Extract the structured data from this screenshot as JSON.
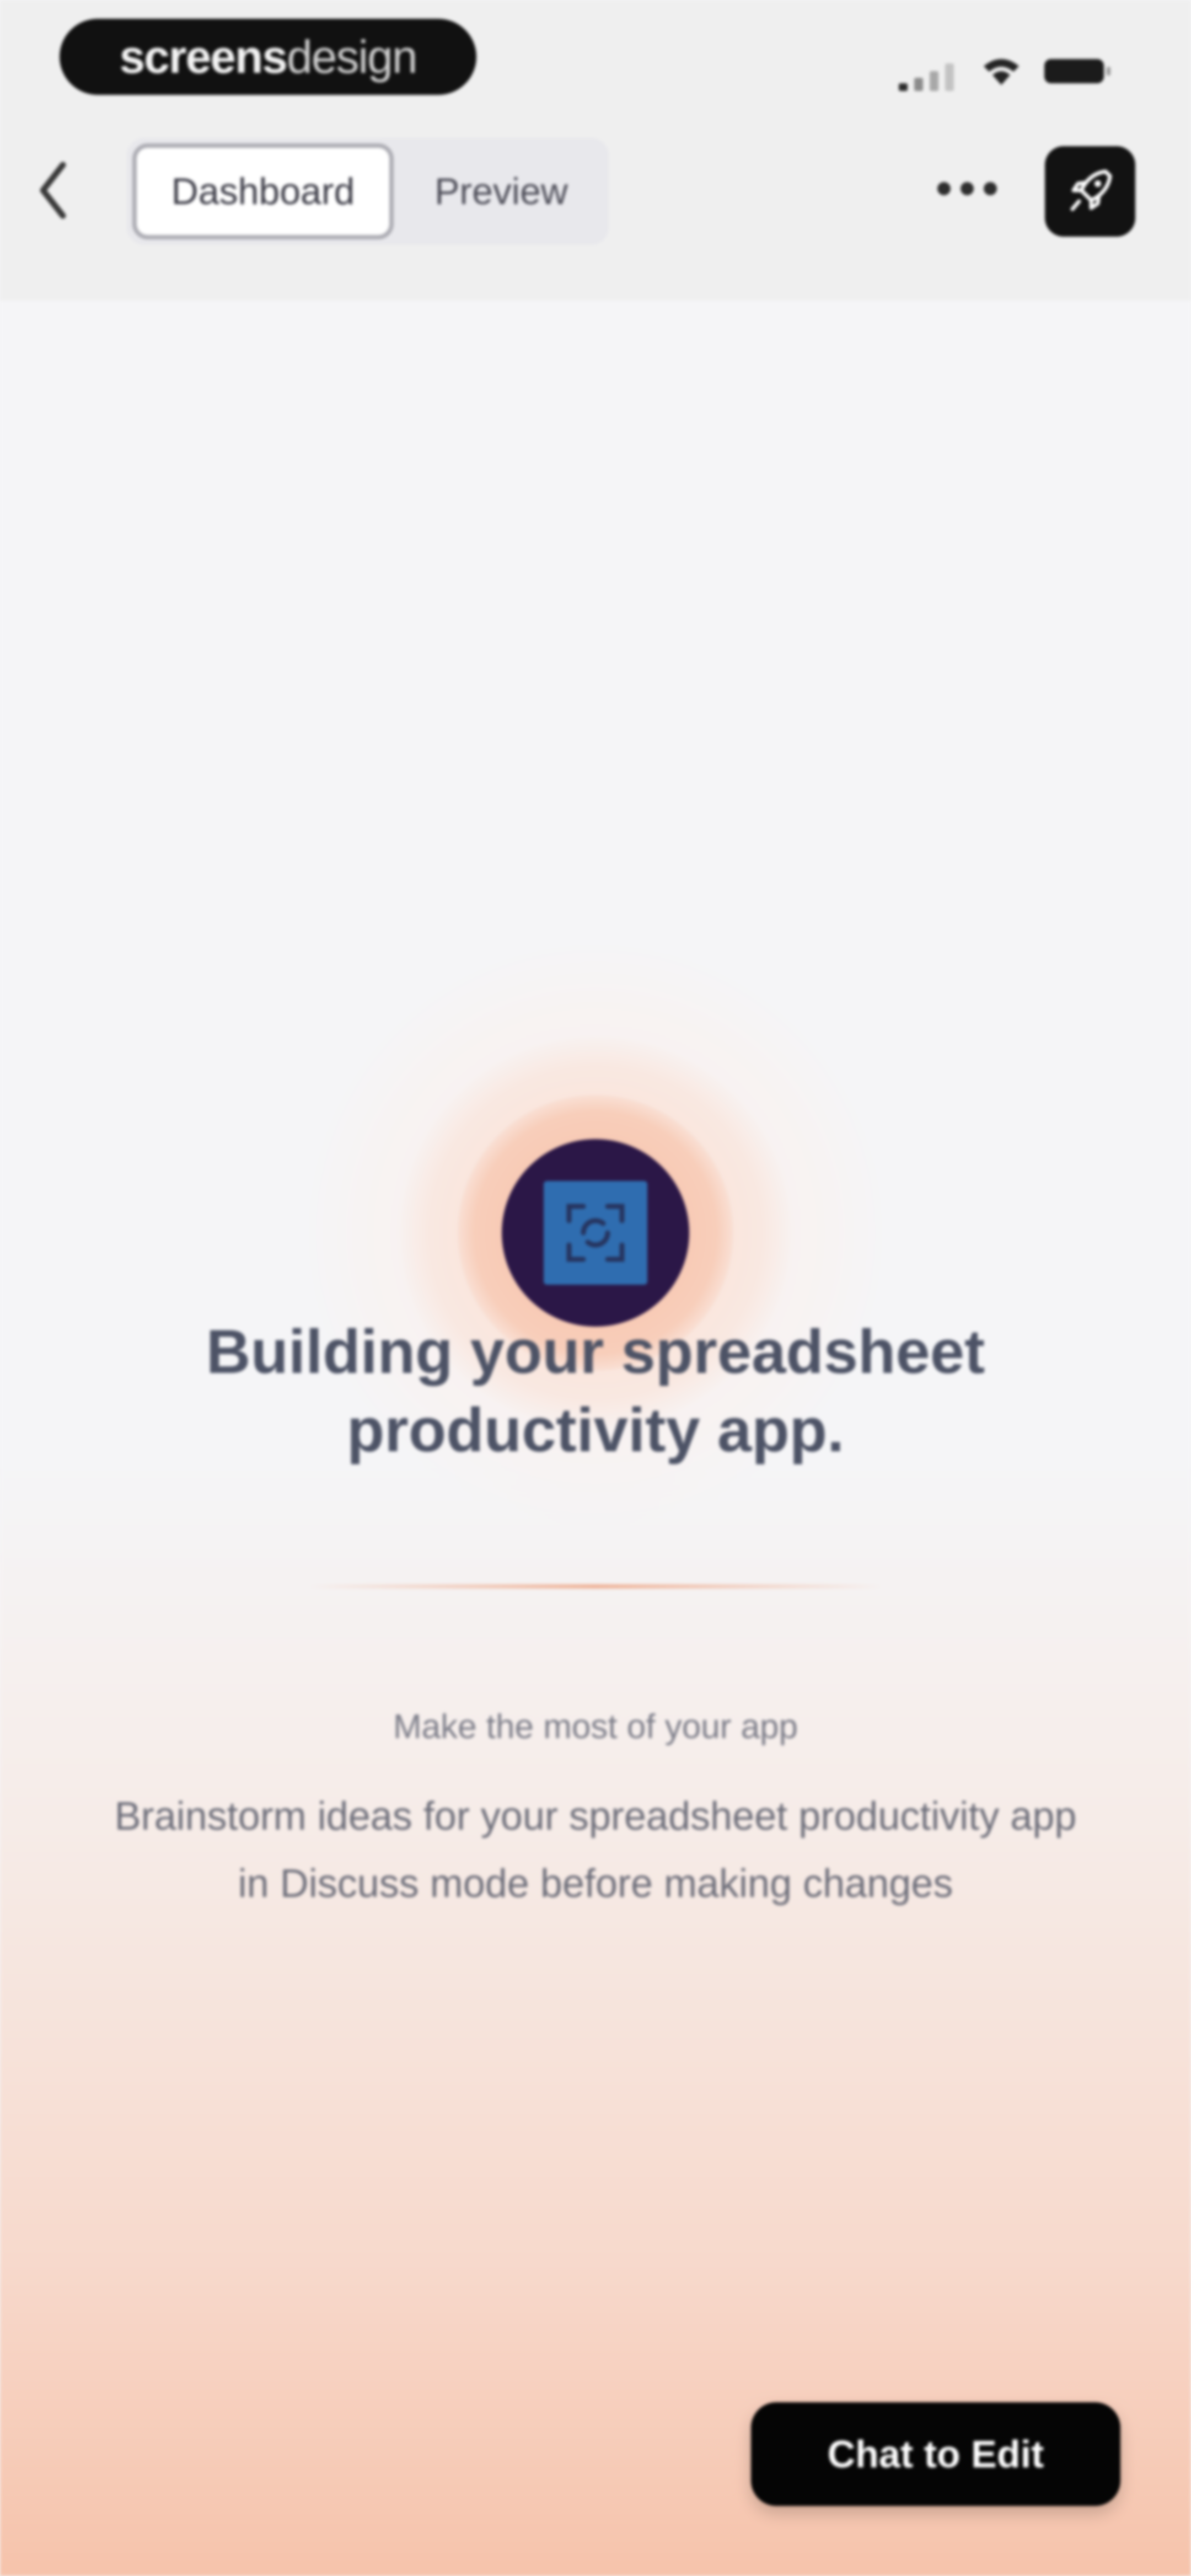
{
  "watermark": {
    "bold": "screens",
    "light": "design"
  },
  "status_bar": {
    "signal_icon": "signal-icon",
    "wifi_icon": "wifi-icon",
    "battery_icon": "battery-icon"
  },
  "header": {
    "back_icon": "chevron-left-icon",
    "tabs": [
      {
        "label": "Dashboard",
        "active": true
      },
      {
        "label": "Preview",
        "active": false
      }
    ],
    "more_icon": "more-horizontal-icon",
    "publish_icon": "rocket-icon"
  },
  "main": {
    "logo_icon": "app-scan-icon",
    "title": "Building your spreadsheet productivity app.",
    "subtitle": "Make the most of your app",
    "description": "Brainstorm ideas for your spreadsheet productivity app in Discuss mode before making changes"
  },
  "footer": {
    "chat_button_label": "Chat to Edit"
  },
  "colors": {
    "accent_dark": "#121212",
    "logo_circle": "#2b1747",
    "logo_square": "#2f6db0",
    "gradient_bottom": "#f6c3ab",
    "halo": "#f6bda3"
  }
}
